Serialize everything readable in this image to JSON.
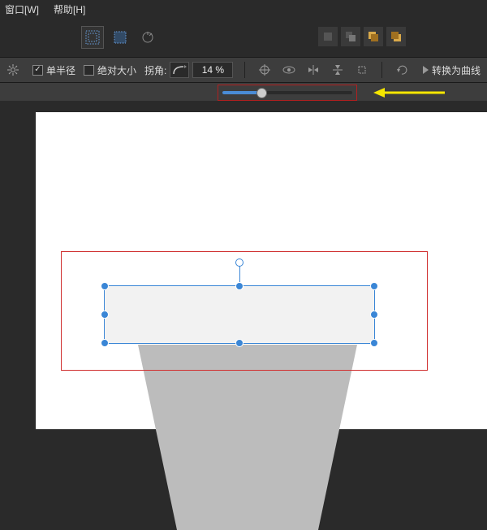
{
  "menu": {
    "window": "窗口[W]",
    "help": "帮助[H]"
  },
  "options": {
    "single_radius_label": "单半径",
    "single_radius_checked": true,
    "absolute_size_label": "绝对大小",
    "absolute_size_checked": false,
    "corner_label": "拐角:",
    "corner_percent": "14 %",
    "convert_label": "转换为曲线"
  },
  "icons": {
    "grid": "grid-icon",
    "grid2": "grid-dense-icon",
    "snap": "snap-icon",
    "layer_fwd": "layer-forward-icon",
    "layer_bwd": "layer-backward-icon"
  }
}
